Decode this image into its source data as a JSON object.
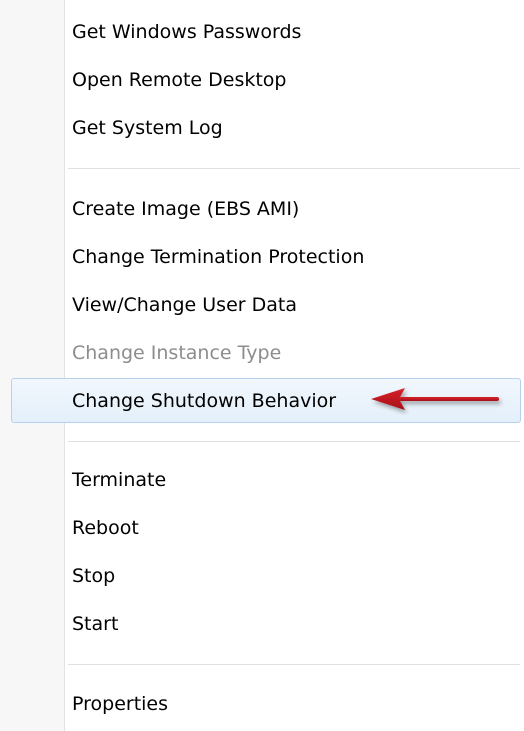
{
  "menu": {
    "items": [
      {
        "label": "Get Windows Passwords"
      },
      {
        "label": "Open Remote Desktop"
      },
      {
        "label": "Get System Log"
      },
      {
        "label": "Create Image (EBS AMI)"
      },
      {
        "label": "Change Termination Protection"
      },
      {
        "label": "View/Change User Data"
      },
      {
        "label": "Change Instance Type",
        "disabled": true
      },
      {
        "label": "Change Shutdown Behavior",
        "highlighted": true
      },
      {
        "label": "Terminate"
      },
      {
        "label": "Reboot"
      },
      {
        "label": "Stop"
      },
      {
        "label": "Start"
      },
      {
        "label": "Properties"
      }
    ]
  },
  "annotation": {
    "icon": "red-arrow-icon",
    "color": "#c1121c"
  },
  "colors": {
    "highlight_border": "#b6d1ee",
    "highlight_fill": "#e8f1fb",
    "disabled_text": "#8d8d8d"
  }
}
